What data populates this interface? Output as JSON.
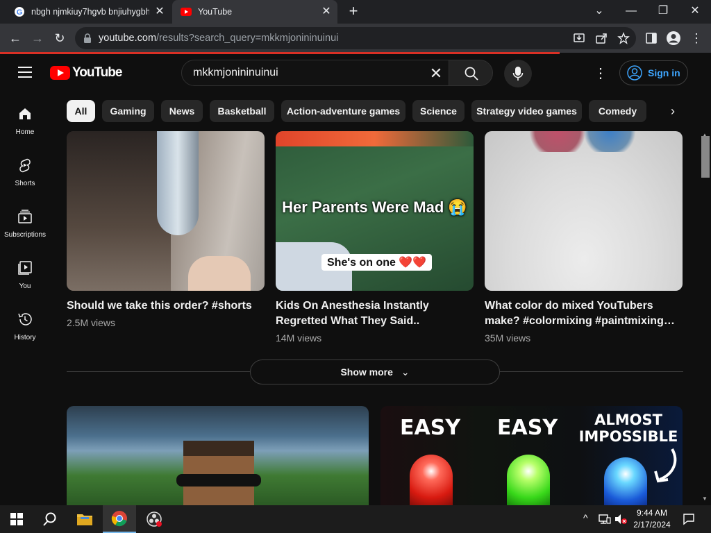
{
  "browser": {
    "tabs": [
      {
        "title": "nbgh njmkiuy7hgvb bnjiuhygbh",
        "active": false
      },
      {
        "title": "YouTube",
        "active": true
      }
    ],
    "url_host": "youtube.com",
    "url_path": "/results?search_query=mkkmjonininuinui"
  },
  "youtube": {
    "logo_text": "YouTube",
    "search_query": "mkkmjonininuinui",
    "sign_in_label": "Sign in",
    "chips": [
      "All",
      "Gaming",
      "News",
      "Basketball",
      "Action-adventure games",
      "Science",
      "Strategy video games",
      "Comedy"
    ],
    "guide": [
      {
        "label": "Home",
        "icon": "home-icon"
      },
      {
        "label": "Shorts",
        "icon": "shorts-icon"
      },
      {
        "label": "Subscriptions",
        "icon": "subscriptions-icon"
      },
      {
        "label": "You",
        "icon": "you-icon"
      },
      {
        "label": "History",
        "icon": "history-icon"
      }
    ],
    "shorts": [
      {
        "title": "Should we take this order? #shorts",
        "views": "2.5M views"
      },
      {
        "title": "Kids On Anesthesia Instantly Regretted What They Said..",
        "views": "14M views",
        "overlay_main": "Her Parents Were Mad 😭",
        "overlay_sub": "She's on one ❤️❤️"
      },
      {
        "title": "What color do mixed YouTubers make? #colormixing #paintmixing…",
        "views": "35M views"
      }
    ],
    "show_more_label": "Show more",
    "video_thumb_texts": {
      "easy1": "EASY",
      "easy2": "EASY",
      "almost": "ALMOST",
      "impossible": "IMPOSSIBLE"
    }
  },
  "taskbar": {
    "time": "9:44 AM",
    "date": "2/17/2024"
  },
  "colors": {
    "yt_red": "#ff0000",
    "link_blue": "#3ea6ff",
    "bg": "#0f0f0f"
  }
}
